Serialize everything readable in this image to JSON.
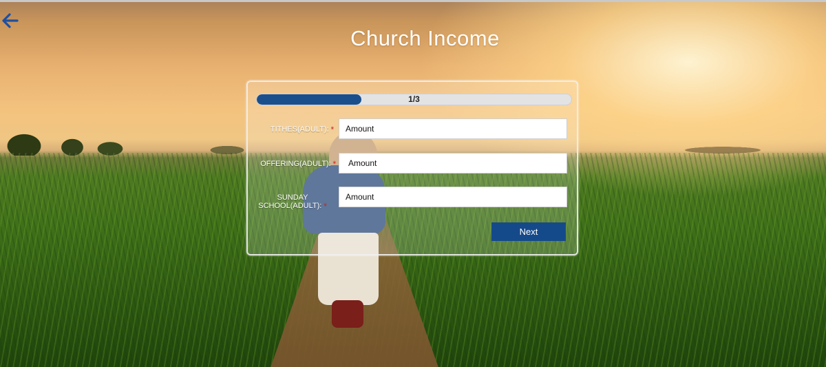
{
  "page": {
    "title": "Church Income"
  },
  "progress": {
    "text": "1/3",
    "fraction": 0.333,
    "fill_color": "#1b4f8c"
  },
  "form": {
    "fields": [
      {
        "label": "TITHES(ADULT):",
        "required_mark": "*",
        "placeholder": "Amount"
      },
      {
        "label": "OFFERING(ADULT):",
        "required_mark": "*",
        "placeholder": "Amount"
      },
      {
        "label_line1": "SUNDAY",
        "label_line2": "SCHOOL(ADULT):",
        "required_mark": "*",
        "placeholder": "Amount"
      }
    ],
    "next_label": "Next"
  },
  "icons": {
    "back": "arrow-left-icon"
  },
  "colors": {
    "accent": "#154a8a",
    "required": "#e0312b"
  }
}
